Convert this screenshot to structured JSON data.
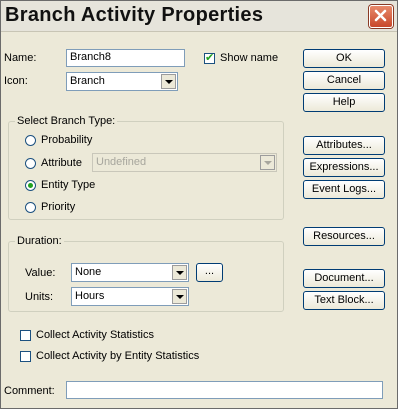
{
  "window": {
    "title": "Branch Activity Properties"
  },
  "name": {
    "label": "Name:",
    "value": "Branch8",
    "show_name_label": "Show name",
    "show_name_checked": true
  },
  "icon": {
    "label": "Icon:",
    "value": "Branch"
  },
  "branch_type": {
    "legend": "Select Branch Type:",
    "options": [
      "Probability",
      "Attribute",
      "Entity Type",
      "Priority"
    ],
    "selected": "Entity Type",
    "attribute_value": "Undefined"
  },
  "duration": {
    "legend": "Duration:",
    "value_label": "Value:",
    "value": "None",
    "browse_label": "...",
    "units_label": "Units:",
    "units": "Hours"
  },
  "stats": {
    "collect_activity": "Collect Activity Statistics",
    "collect_entity": "Collect Activity by Entity Statistics"
  },
  "comment": {
    "label": "Comment:",
    "value": ""
  },
  "buttons": {
    "ok": "OK",
    "cancel": "Cancel",
    "help": "Help",
    "attributes": "Attributes...",
    "expressions": "Expressions...",
    "event_logs": "Event Logs...",
    "resources": "Resources...",
    "document": "Document...",
    "text_block": "Text Block..."
  }
}
